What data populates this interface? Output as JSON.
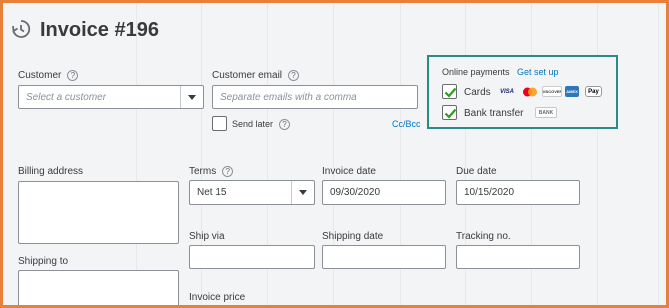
{
  "header": {
    "title": "Invoice #196"
  },
  "customer": {
    "label": "Customer",
    "placeholder": "Select a customer"
  },
  "customer_email": {
    "label": "Customer email",
    "placeholder": "Separate emails with a comma",
    "send_later_label": "Send later",
    "cc_bcc_link": "Cc/Bcc"
  },
  "online_payments": {
    "label": "Online payments",
    "setup_link": "Get set up",
    "cards_label": "Cards",
    "bank_label": "Bank transfer",
    "card_logos": [
      "VISA",
      "mastercard",
      "DISCOVER",
      "AMEX",
      "Pay"
    ],
    "bank_logo": "BANK",
    "cards_checked": true,
    "bank_checked": true
  },
  "billing": {
    "billing_address_label": "Billing address",
    "shipping_to_label": "Shipping to"
  },
  "terms": {
    "label": "Terms",
    "value": "Net 15"
  },
  "invoice_date": {
    "label": "Invoice date",
    "value": "09/30/2020"
  },
  "due_date": {
    "label": "Due date",
    "value": "10/15/2020"
  },
  "ship_via": {
    "label": "Ship via"
  },
  "shipping_date": {
    "label": "Shipping date"
  },
  "tracking": {
    "label": "Tracking no."
  },
  "invoice_price": {
    "label": "Invoice price"
  },
  "colors": {
    "frame": "#e8803a",
    "highlight": "#2a8a86",
    "check": "#2ca01c",
    "link": "#0077c5"
  }
}
